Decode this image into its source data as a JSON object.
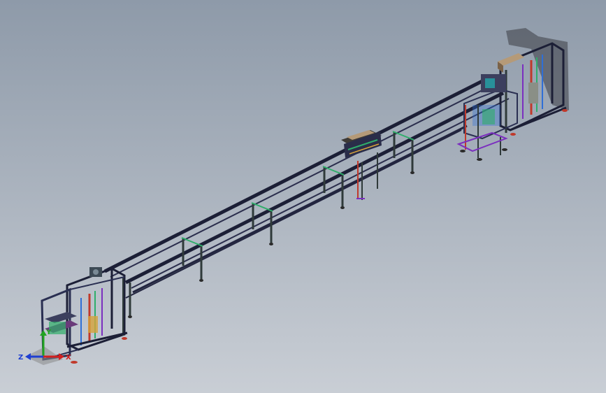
{
  "viewport": {
    "background_top": "#8e9aa9",
    "background_bottom": "#c9ced5"
  },
  "model": {
    "frame_colors": [
      "#1b1f3a",
      "#2a2f52",
      "#3c3f5e"
    ],
    "accent_colors": [
      "#2fae6a",
      "#c0392b",
      "#7b2fbf",
      "#2f6fd6",
      "#1fb3b3",
      "#d6a23c"
    ]
  },
  "triad": {
    "z_label": "Z",
    "y_label": "Y",
    "x_label": "X",
    "x_color": "#d21f1f",
    "y_color": "#21a321",
    "z_color": "#1f3fd2"
  }
}
